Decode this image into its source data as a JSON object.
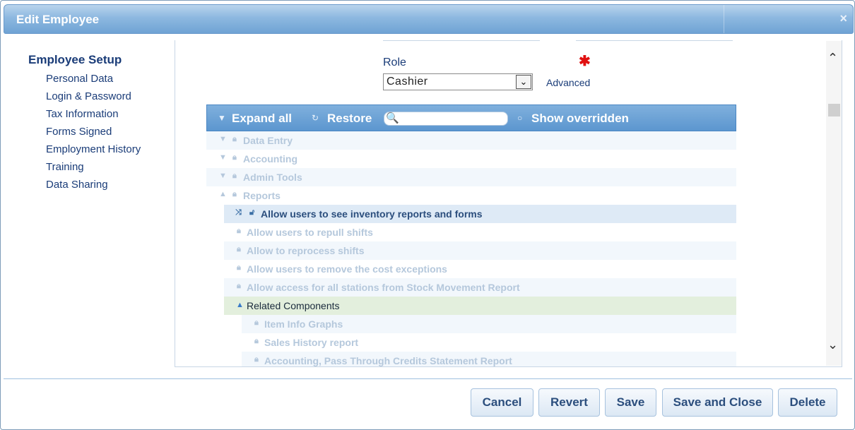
{
  "window": {
    "title": "Edit Employee",
    "close_glyph": "×"
  },
  "nav": {
    "title": "Employee Setup",
    "items": [
      "Personal Data",
      "Login & Password",
      "Tax Information",
      "Forms Signed",
      "Employment History",
      "Training",
      "Data Sharing"
    ]
  },
  "role": {
    "label": "Role",
    "required_glyph": "✱",
    "value": "Cashier",
    "advanced_label": "Advanced"
  },
  "toolbar": {
    "expand_label": "Expand all",
    "restore_label": "Restore",
    "search_value": "",
    "show_overridden_label": "Show overridden"
  },
  "tree": {
    "data_entry": "Data Entry",
    "accounting": "Accounting",
    "admin_tools": "Admin Tools",
    "reports": "Reports",
    "inventory_reports": "Allow users to see inventory reports and forms",
    "repull": "Allow users to repull shifts",
    "reprocess": "Allow to reprocess shifts",
    "cost_exceptions": "Allow users to remove the cost exceptions",
    "stock_movement": "Allow access for all stations from Stock Movement Report",
    "related": "Related Components",
    "item_info": "Item Info Graphs",
    "sales_history": "Sales History report",
    "accounting_pass": "Accounting, Pass Through Credits Statement Report"
  },
  "buttons": {
    "cancel": "Cancel",
    "revert": "Revert",
    "save": "Save",
    "save_close": "Save and Close",
    "delete": "Delete"
  },
  "colors": {
    "accent": "#5c96cf",
    "title_bar": "#8db8e0",
    "highlight_box": "#dd4444",
    "related_bg": "#e3efdd"
  }
}
